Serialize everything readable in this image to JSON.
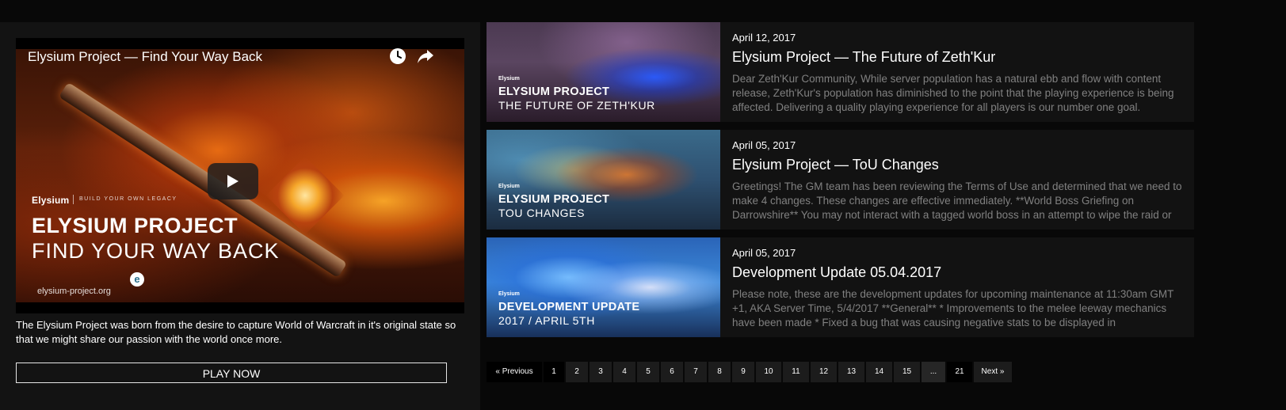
{
  "video": {
    "title": "Elysium Project — Find Your Way Back",
    "brand": "Elysium",
    "tagline": "BUILD YOUR OWN LEGACY",
    "heading": "ELYSIUM PROJECT",
    "subheading": "FIND YOUR WAY BACK",
    "logo_letter": "e",
    "site": "elysium-project.org",
    "icons": [
      "clock-icon",
      "share-icon",
      "play-icon"
    ]
  },
  "intro": {
    "text": "The Elysium Project was born from the desire to capture World of Warcraft in it's original state so that we might share our passion with the world once more.",
    "play_now_label": "PLAY NOW"
  },
  "news": [
    {
      "date": "April 12, 2017",
      "title": "Elysium Project — The Future of Zeth'Kur",
      "excerpt": "Dear Zeth'Kur Community, While server population has a natural ebb and flow with content release, Zeth'Kur's population has diminished to the point that the playing experience is being affected. Delivering a quality playing experience for all players is our number one goal.",
      "thumb_brand": "Elysium",
      "thumb_title": "ELYSIUM PROJECT",
      "thumb_subtitle": "THE FUTURE OF ZETH'KUR"
    },
    {
      "date": "April 05, 2017",
      "title": "Elysium Project — ToU Changes",
      "excerpt": "Greetings! The GM team has been reviewing the Terms of Use and determined that we need to make 4 changes. These changes are effective immediately. **World Boss Griefing on Darrowshire** You may not interact with a tagged world boss in an attempt to wipe the raid or",
      "thumb_brand": "Elysium",
      "thumb_title": "ELYSIUM PROJECT",
      "thumb_subtitle": "TOU CHANGES"
    },
    {
      "date": "April 05, 2017",
      "title": "Development Update 05.04.2017",
      "excerpt": "Please note, these are the development updates for upcoming maintenance at 11:30am GMT +1, AKA Server Time, 5/4/2017 **General** * Improvements to the melee leeway mechanics have been made * Fixed a bug that was causing negative stats to be displayed in",
      "thumb_brand": "Elysium",
      "thumb_title": "DEVELOPMENT UPDATE",
      "thumb_subtitle": "2017 / APRIL 5TH"
    }
  ],
  "pagination": {
    "prev": "« Previous",
    "pages": [
      "1",
      "2",
      "3",
      "4",
      "5",
      "6",
      "7",
      "8",
      "9",
      "10",
      "11",
      "12",
      "13",
      "14",
      "15"
    ],
    "ellipsis": "...",
    "last": "21",
    "next": "Next »",
    "current": "1"
  }
}
